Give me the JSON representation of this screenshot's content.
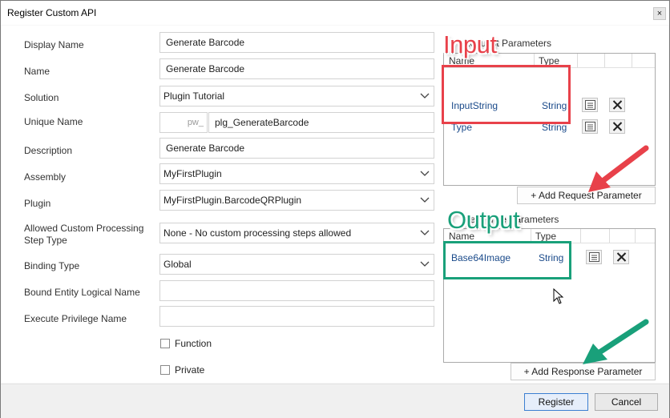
{
  "window": {
    "title": "Register Custom API",
    "close_glyph": "×"
  },
  "form": {
    "display_name": {
      "label": "Display Name",
      "value": "Generate Barcode"
    },
    "name": {
      "label": "Name",
      "value": "Generate Barcode"
    },
    "solution": {
      "label": "Solution",
      "value": "Plugin Tutorial"
    },
    "unique_name": {
      "label": "Unique Name",
      "prefix": "pw_",
      "value": "plg_GenerateBarcode"
    },
    "description": {
      "label": "Description",
      "value": "Generate Barcode"
    },
    "assembly": {
      "label": "Assembly",
      "value": "MyFirstPlugin"
    },
    "plugin": {
      "label": "Plugin",
      "value": "MyFirstPlugin.BarcodeQRPlugin"
    },
    "allowed_processing": {
      "label_line1": "Allowed Custom Processing",
      "label_line2": "Step Type",
      "value": "None - No custom processing steps allowed"
    },
    "binding_type": {
      "label": "Binding Type",
      "value": "Global"
    },
    "bound_entity": {
      "label": "Bound Entity Logical Name",
      "value": ""
    },
    "execute_privilege": {
      "label": "Execute Privilege Name",
      "value": ""
    },
    "function": {
      "label": "Function",
      "checked": false
    },
    "private": {
      "label": "Private",
      "checked": false
    }
  },
  "request_params": {
    "title": "Request Parameters",
    "columns": {
      "name": "Name",
      "type": "Type"
    },
    "rows": [
      {
        "name": "InputString",
        "type": "String"
      },
      {
        "name": "Type",
        "type": "String"
      }
    ],
    "add_button": "+ Add Request Parameter"
  },
  "response_params": {
    "title": "Response Parameters",
    "columns": {
      "name": "Name",
      "type": "Type"
    },
    "rows": [
      {
        "name": "Base64Image",
        "type": "String"
      }
    ],
    "add_button": "+ Add Response Parameter"
  },
  "annotations": {
    "input": {
      "text": "Input",
      "color": "#e8414a"
    },
    "output": {
      "text": "Output",
      "color": "#19a07a"
    }
  },
  "footer": {
    "register": "Register",
    "cancel": "Cancel"
  },
  "colors": {
    "accent": "#3c7fd1",
    "input_annotation": "#e8414a",
    "output_annotation": "#19a07a"
  }
}
